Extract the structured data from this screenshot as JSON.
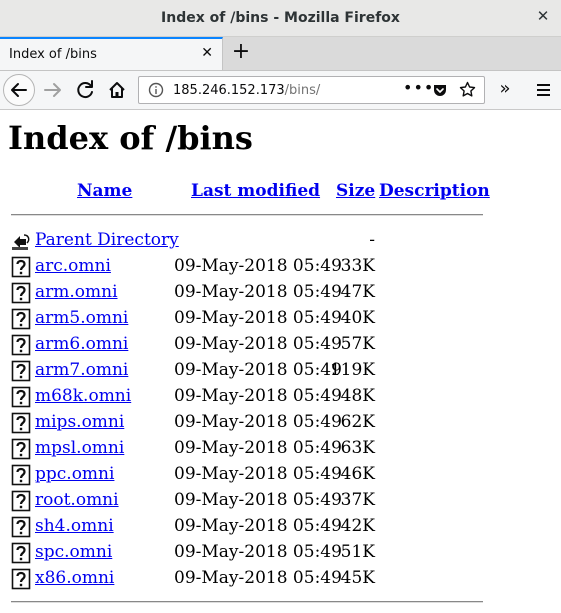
{
  "window": {
    "title": "Index of /bins - Mozilla Firefox",
    "close_glyph": "✕"
  },
  "tabs": [
    {
      "label": "Index of /bins",
      "close_glyph": "✕"
    }
  ],
  "new_tab_glyph": "+",
  "urlbar": {
    "host": "185.246.152.173",
    "path": "/bins/",
    "more_glyph": "•••"
  },
  "toolbar": {
    "overflow_glyph": "»"
  },
  "page": {
    "heading": "Index of /bins",
    "columns": {
      "name": "Name",
      "modified": "Last modified",
      "size": "Size",
      "description": "Description"
    },
    "parent": {
      "name": "Parent Directory",
      "size": "-"
    },
    "files": [
      {
        "name": "arc.omni",
        "modified": "09-May-2018 05:49",
        "size": "33K"
      },
      {
        "name": "arm.omni",
        "modified": "09-May-2018 05:49",
        "size": "47K"
      },
      {
        "name": "arm5.omni",
        "modified": "09-May-2018 05:49",
        "size": "40K"
      },
      {
        "name": "arm6.omni",
        "modified": "09-May-2018 05:49",
        "size": "57K"
      },
      {
        "name": "arm7.omni",
        "modified": "09-May-2018 05:49",
        "size": "119K"
      },
      {
        "name": "m68k.omni",
        "modified": "09-May-2018 05:49",
        "size": "48K"
      },
      {
        "name": "mips.omni",
        "modified": "09-May-2018 05:49",
        "size": "62K"
      },
      {
        "name": "mpsl.omni",
        "modified": "09-May-2018 05:49",
        "size": "63K"
      },
      {
        "name": "ppc.omni",
        "modified": "09-May-2018 05:49",
        "size": "46K"
      },
      {
        "name": "root.omni",
        "modified": "09-May-2018 05:49",
        "size": "37K"
      },
      {
        "name": "sh4.omni",
        "modified": "09-May-2018 05:49",
        "size": "42K"
      },
      {
        "name": "spc.omni",
        "modified": "09-May-2018 05:49",
        "size": "51K"
      },
      {
        "name": "x86.omni",
        "modified": "09-May-2018 05:49",
        "size": "45K"
      }
    ]
  },
  "icons": {
    "window_close": "close-icon",
    "tab_close": "close-icon",
    "new_tab": "plus-icon",
    "back": "back-arrow-icon",
    "forward": "forward-arrow-icon",
    "reload": "reload-icon",
    "home": "home-icon",
    "site_info": "info-icon",
    "page_actions": "more-icon",
    "pocket": "pocket-icon",
    "bookmark": "star-icon",
    "overflow": "chevron-double-right-icon",
    "menu": "hamburger-menu-icon",
    "parent_directory": "back-folder-icon",
    "file": "unknown-file-icon"
  },
  "colors": {
    "link": "#0000ee",
    "tab_accent": "#0a84ff"
  }
}
